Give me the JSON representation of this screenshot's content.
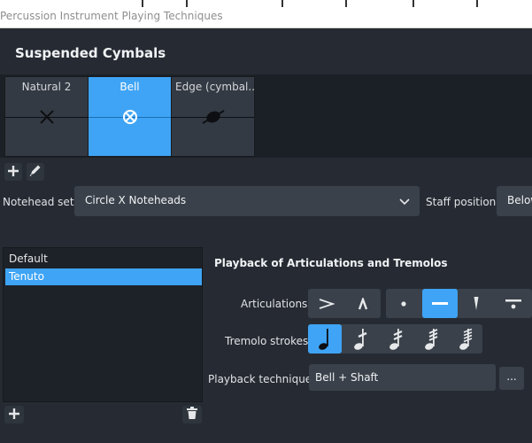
{
  "window": {
    "title": "Percussion Instrument Playing Techniques"
  },
  "group": {
    "title": "Suspended Cymbals"
  },
  "cells": [
    {
      "label": "Natural 2",
      "glyph": "x-notehead-icon"
    },
    {
      "label": "Bell",
      "glyph": "circle-x-notehead-icon"
    },
    {
      "label": "Edge (cymbal...",
      "glyph": "slashed-oval-notehead-icon"
    }
  ],
  "toolbar": {
    "add_icon": "plus-icon",
    "edit_icon": "pencil-icon"
  },
  "notehead": {
    "label": "Notehead set:",
    "value": "Circle X Noteheads"
  },
  "staff": {
    "label": "Staff position:",
    "value": "Below"
  },
  "techniques": {
    "items": [
      "Default",
      "Tenuto"
    ],
    "selected": "Tenuto"
  },
  "playback": {
    "section_title": "Playback of Articulations and Tremolos",
    "articulations_label": "Articulations:",
    "tremolo_label": "Tremolo strokes:",
    "technique_label": "Playback technique:",
    "technique_value": "Bell + Shaft",
    "more_label": "...",
    "articulation_buttons": [
      "accent-icon",
      "marcato-icon",
      "staccato-icon",
      "tenuto-icon",
      "staccatissimo-icon",
      "tenuto-staccato-icon"
    ],
    "selected_articulation": "tenuto-icon",
    "tremolo_buttons": [
      "tremolo-0-icon",
      "tremolo-1-icon",
      "tremolo-2-icon",
      "tremolo-3-icon",
      "tremolo-4-icon"
    ],
    "selected_tremolo": "tremolo-0-icon"
  },
  "colors": {
    "accent": "#3fa4f5",
    "background": "#262b33",
    "panel": "#1b2026"
  }
}
